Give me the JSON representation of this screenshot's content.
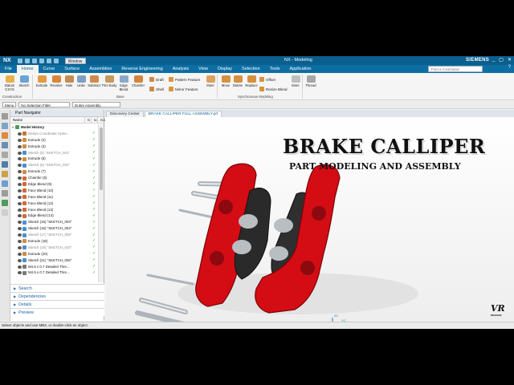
{
  "titlebar": {
    "app_logo": "NX",
    "window_menu": "Window",
    "app_title": "NX - Modeling",
    "brand": "SIEMENS",
    "window_buttons": [
      "_",
      "▢",
      "✕"
    ]
  },
  "menu": {
    "tabs": [
      "File",
      "Home",
      "Curve",
      "Surface",
      "Assemblies",
      "Reverse Engineering",
      "Analysis",
      "View",
      "Display",
      "Selection",
      "Tools",
      "Application"
    ],
    "active_tab": "Home",
    "search_placeholder": "Find a Command",
    "help": "?"
  },
  "ribbon": {
    "buttons": {
      "datum": "Datum CSYS",
      "sketch": "Sketch",
      "extrude": "Extrude",
      "revolve": "Revolve",
      "hole": "Hole",
      "unite": "Unite",
      "subtract": "Subtract",
      "trim_body": "Trim Body",
      "edge_blend": "Edge Blend",
      "chamfer": "Chamfer",
      "draft": "Draft",
      "shell": "Shell",
      "pattern_feature": "Pattern Feature",
      "mirror_feature": "Mirror Feature",
      "more1": "More",
      "move": "Move",
      "delete": "Delete",
      "replace": "Replace",
      "offset": "Offset",
      "resize_blend": "Resize Blend",
      "more2": "More",
      "thread": "Thread"
    },
    "groups": [
      "Construction",
      "Base",
      "Synchronous Modeling"
    ]
  },
  "selection_bar": {
    "menu": "Menu",
    "filter": "No Selection Filter",
    "scope": "Entire Assembly"
  },
  "navigator": {
    "title": "Part Navigator",
    "columns": [
      "Name",
      "C",
      "U..",
      "Co.."
    ],
    "root": "Model History",
    "features": [
      {
        "label": "Datum Coordinate Syste...",
        "dim": true,
        "color": "#c0762c"
      },
      {
        "label": "Extrude (2)",
        "dim": false,
        "color": "#d38b3e"
      },
      {
        "label": "Extrude (3)",
        "dim": false,
        "color": "#d38b3e"
      },
      {
        "label": "Sketch (5) \"SKETCH_001\"",
        "dim": true,
        "color": "#4a8fcf"
      },
      {
        "label": "Extrude (5)",
        "dim": false,
        "color": "#d38b3e"
      },
      {
        "label": "Sketch (6) \"SKETCH_002\"",
        "dim": true,
        "color": "#4a8fcf"
      },
      {
        "label": "Extrude (7)",
        "dim": false,
        "color": "#d38b3e"
      },
      {
        "label": "Chamfer (8)",
        "dim": false,
        "color": "#cf6a3a"
      },
      {
        "label": "Edge Blend (9)",
        "dim": false,
        "color": "#cf6a3a"
      },
      {
        "label": "Face Blend (10)",
        "dim": false,
        "color": "#cf6a3a"
      },
      {
        "label": "Face Blend (11)",
        "dim": false,
        "color": "#cf6a3a"
      },
      {
        "label": "Face Blend (12)",
        "dim": false,
        "color": "#cf6a3a"
      },
      {
        "label": "Face Blend (13)",
        "dim": false,
        "color": "#cf6a3a"
      },
      {
        "label": "Edge Blend (14)",
        "dim": false,
        "color": "#cf6a3a"
      },
      {
        "label": "Sketch (15) \"SKETCH_003\"",
        "dim": false,
        "color": "#4a8fcf"
      },
      {
        "label": "Sketch (16) \"SKETCH_004\"",
        "dim": false,
        "color": "#4a8fcf"
      },
      {
        "label": "Sketch (17) \"SKETCH_005\"",
        "dim": true,
        "color": "#4a8fcf"
      },
      {
        "label": "Extrude (18)",
        "dim": false,
        "color": "#d38b3e"
      },
      {
        "label": "Sketch (19) \"SKETCH_010\"",
        "dim": true,
        "color": "#4a8fcf"
      },
      {
        "label": "Extrude (20)",
        "dim": false,
        "color": "#d38b3e"
      },
      {
        "label": "Sketch (21) \"SKETCH_006\"",
        "dim": false,
        "color": "#4a8fcf"
      },
      {
        "label": "M4.5 x 0.7 Detailed Thre...",
        "dim": false,
        "color": "#7a7a7a"
      },
      {
        "label": "M4.5 x 0.7 Detailed Thre...",
        "dim": false,
        "color": "#7a7a7a"
      }
    ],
    "panels": [
      "Search",
      "Dependencies",
      "Details",
      "Preview"
    ]
  },
  "viewport": {
    "tabs": [
      "Discovery Center",
      "BRAKE CALLIPER FULL ASSEMBLY.prt"
    ],
    "active_tab": "BRAKE CALLIPER FULL ASSEMBLY.prt",
    "title": "BRAKE CALLIPER",
    "subtitle": "PART MODELING AND ASSEMBLY",
    "logo": "VR",
    "logo_sub": "DESIGNS",
    "triad": {
      "x": "XC",
      "y": "YC",
      "z": "ZC"
    }
  },
  "status": "Select objects and use MB3, or double-click an object",
  "colors": {
    "caliper_red": "#d40c14",
    "pad_dark": "#2a2a2a",
    "titlebar_blue": "#0b5f8e",
    "check_green": "#2b9a3a"
  }
}
